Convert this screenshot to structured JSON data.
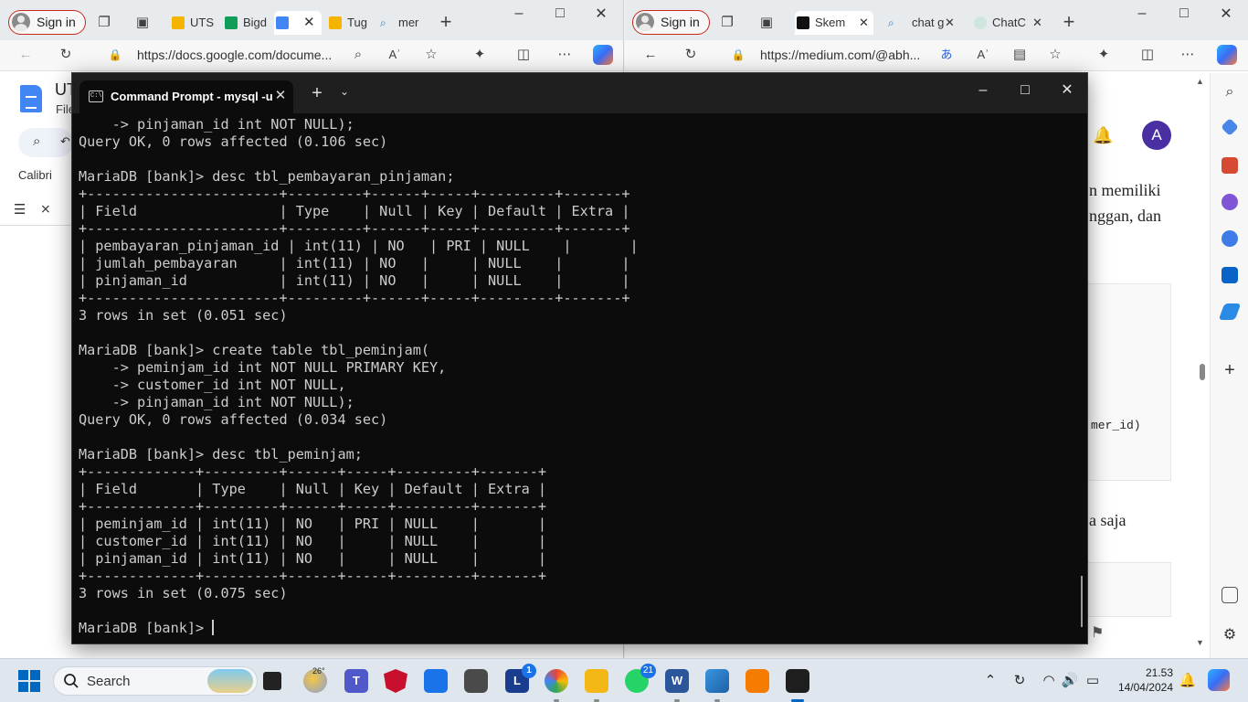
{
  "left_browser": {
    "signin_label": "Sign in",
    "tabs": [
      {
        "label": "UTS",
        "color": "#4285f4"
      },
      {
        "label": "Bigd",
        "color": "#4285f4"
      },
      {
        "label": "",
        "color": "#4285f4",
        "active": true
      },
      {
        "label": "Tug",
        "color": "#34a853"
      },
      {
        "label": "mer",
        "color": "#2b7cd3"
      }
    ],
    "url": "https://docs.google.com/docume...",
    "doc": {
      "title": "UT",
      "file_menu": "File",
      "font_name": "Calibri"
    }
  },
  "right_browser": {
    "signin_label": "Sign in",
    "tabs": [
      {
        "label": "Skem",
        "active": true
      },
      {
        "label": "chat g"
      },
      {
        "label": "ChatC"
      }
    ],
    "url": "https://medium.com/@abh...",
    "avatar_letter": "A",
    "text_lines": [
      "n memiliki",
      "nggan, dan"
    ],
    "code_fragment": "mer_id)",
    "text_line_bottom": "a saja"
  },
  "terminal": {
    "title": "Command Prompt - mysql  -u",
    "lines": [
      "    -> pinjaman_id int NOT NULL);",
      "Query OK, 0 rows affected (0.106 sec)",
      "",
      "MariaDB [bank]> desc tbl_pembayaran_pinjaman;",
      "+-----------------------+---------+------+-----+---------+-------+",
      "| Field                 | Type    | Null | Key | Default | Extra |",
      "+-----------------------+---------+------+-----+---------+-------+",
      "| pembayaran_pinjaman_id | int(11) | NO   | PRI | NULL    |       |",
      "| jumlah_pembayaran     | int(11) | NO   |     | NULL    |       |",
      "| pinjaman_id           | int(11) | NO   |     | NULL    |       |",
      "+-----------------------+---------+------+-----+---------+-------+",
      "3 rows in set (0.051 sec)",
      "",
      "MariaDB [bank]> create table tbl_peminjam(",
      "    -> peminjam_id int NOT NULL PRIMARY KEY,",
      "    -> customer_id int NOT NULL,",
      "    -> pinjaman_id int NOT NULL);",
      "Query OK, 0 rows affected (0.034 sec)",
      "",
      "MariaDB [bank]> desc tbl_peminjam;",
      "+-------------+---------+------+-----+---------+-------+",
      "| Field       | Type    | Null | Key | Default | Extra |",
      "+-------------+---------+------+-----+---------+-------+",
      "| peminjam_id | int(11) | NO   | PRI | NULL    |       |",
      "| customer_id | int(11) | NO   |     | NULL    |       |",
      "| pinjaman_id | int(11) | NO   |     | NULL    |       |",
      "+-------------+---------+------+-----+---------+-------+",
      "3 rows in set (0.075 sec)",
      ""
    ],
    "prompt": "MariaDB [bank]> "
  },
  "taskbar": {
    "search_label": "Search",
    "weather_temp": "26°",
    "teams_label": "T",
    "lens_label": "L",
    "badges": {
      "lens": "1",
      "whatsapp": "21"
    },
    "word_label": "W",
    "clock_time": "21.53",
    "clock_date": "14/04/2024"
  },
  "colors": {
    "terminal_bg": "#0c0c0c",
    "terminal_fg": "#cccccc",
    "accent": "#0067c0",
    "signin_border": "#c42b1c"
  }
}
